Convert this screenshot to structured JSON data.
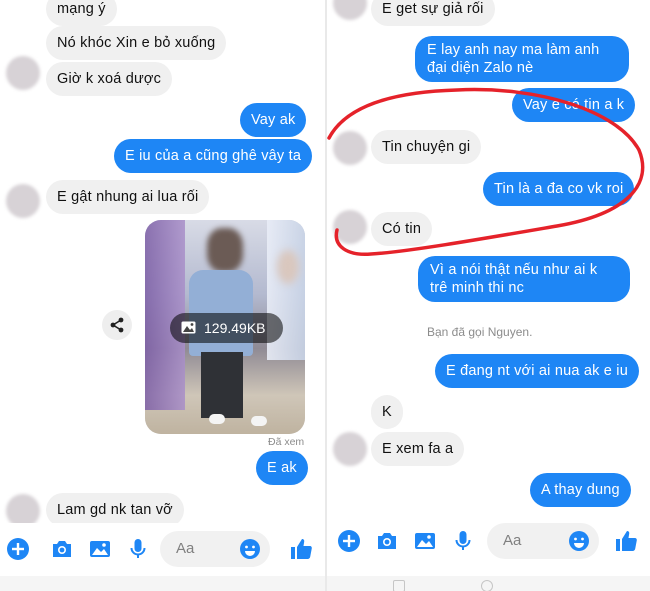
{
  "colors": {
    "outgoing": "#1e86f5",
    "incoming": "#f0f0f0",
    "accent": "#1e86f5",
    "annotation": "#e5222a"
  },
  "left": {
    "messages": [
      {
        "dir": "in",
        "text": "mạng ý"
      },
      {
        "dir": "in",
        "text": "Nó khóc  Xin  e bỏ xuống"
      },
      {
        "dir": "in",
        "text": "Giờ  k xoá dược"
      },
      {
        "dir": "out",
        "text": "Vay ak"
      },
      {
        "dir": "out",
        "text": "E iu của a cũng ghê vây ta"
      },
      {
        "dir": "in",
        "text": "E gật nhung ai lua rối"
      },
      {
        "dir": "out",
        "text": "E ak"
      },
      {
        "dir": "in",
        "text": "Lam gd nk tan vỡ"
      }
    ],
    "attachment": {
      "size": "129.49KB",
      "icon": "image-icon"
    },
    "seen": "Đã xem",
    "composer": {
      "placeholder": "Aa"
    }
  },
  "right": {
    "messages": [
      {
        "dir": "in",
        "text": "E get sự giả rối"
      },
      {
        "dir": "out",
        "text": "E lay anh nay ma làm anh đại diện Zalo nè"
      },
      {
        "dir": "out",
        "text": "Vay e có tin a k"
      },
      {
        "dir": "in",
        "text": "Tin  chuyện gi"
      },
      {
        "dir": "out",
        "text": "Tin là a đa co vk roi"
      },
      {
        "dir": "in",
        "text": "Có  tin"
      },
      {
        "dir": "out",
        "text": "Vì a nói thật nếu như ai k trê minh thi nc"
      },
      {
        "dir": "out",
        "text": "E đang nt với ai nua ak e iu"
      },
      {
        "dir": "in",
        "text": "K"
      },
      {
        "dir": "in",
        "text": "E xem  fa a"
      },
      {
        "dir": "out",
        "text": "A thay dung"
      }
    ],
    "call_note": "Bạn đã gọi Nguyen.",
    "composer": {
      "placeholder": "Aa"
    }
  }
}
